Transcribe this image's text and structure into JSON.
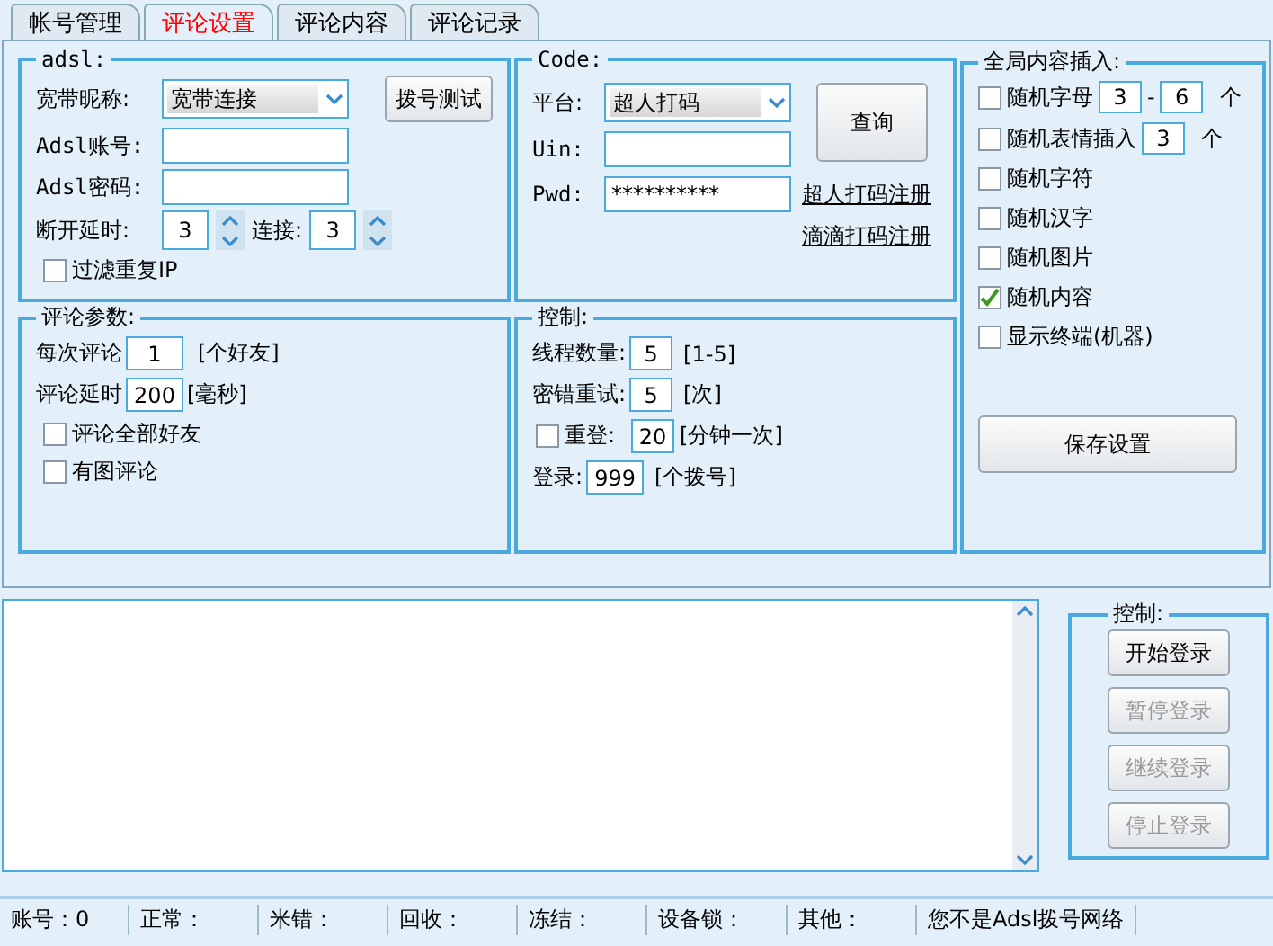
{
  "tabs": [
    {
      "label": "帐号管理",
      "selected": false
    },
    {
      "label": "评论设置",
      "selected": true
    },
    {
      "label": "评论内容",
      "selected": false
    },
    {
      "label": "评论记录",
      "selected": false
    }
  ],
  "adsl": {
    "legend": "adsl:",
    "nickname": {
      "label": "宽带昵称:",
      "value": "宽带连接"
    },
    "account": {
      "label": "Adsl账号:"
    },
    "password": {
      "label": "Adsl密码:"
    },
    "dial_test_button": "拨号测试",
    "delay": {
      "label": "断开延时:",
      "value": "3"
    },
    "connect": {
      "label": "连接:",
      "value": "3"
    },
    "filter_ip": {
      "label": "过滤重复IP",
      "checked": false
    }
  },
  "comment_params": {
    "legend": "评论参数:",
    "rows": [
      {
        "label": "每次评论",
        "value": "1",
        "unit": "[个好友]"
      },
      {
        "label": "评论延时",
        "value": "200",
        "unit": "[毫秒]"
      }
    ],
    "checkboxes": [
      {
        "label": "评论全部好友",
        "checked": false
      },
      {
        "label": "有图评论",
        "checked": false
      }
    ]
  },
  "code": {
    "legend": "Code:",
    "platform": {
      "label": "平台:",
      "value": "超人打码"
    },
    "uin": {
      "label": "Uin:"
    },
    "pwd": {
      "label": "Pwd:",
      "value": "**********"
    },
    "query_button": "查询",
    "links": [
      "超人打码注册",
      "滴滴打码注册"
    ]
  },
  "control": {
    "legend": "控制:",
    "rows": [
      {
        "kind": "field",
        "label": "线程数量:",
        "value": "5",
        "unit": "[1-5]"
      },
      {
        "kind": "field",
        "label": "密错重试:",
        "value": "5",
        "unit": "[次]"
      },
      {
        "kind": "checkbox",
        "label": "重登:",
        "checked": false,
        "value": "20",
        "unit": "[分钟一次]"
      },
      {
        "kind": "field",
        "label": "登录:",
        "value": "999",
        "unit": "[个拨号]"
      }
    ]
  },
  "global_insert": {
    "legend": "全局内容插入:",
    "options": [
      {
        "label": "随机字母",
        "checked": false,
        "values": [
          "3",
          "6"
        ],
        "separator": "-",
        "unit": "个"
      },
      {
        "label": "随机表情插入",
        "checked": false,
        "values": [
          "3"
        ],
        "unit": "个"
      },
      {
        "label": "随机字符",
        "checked": false
      },
      {
        "label": "随机汉字",
        "checked": false
      },
      {
        "label": "随机图片",
        "checked": false
      },
      {
        "label": "随机内容",
        "checked": true
      },
      {
        "label": "显示终端(机器)",
        "checked": false
      }
    ],
    "save_button": "保存设置"
  },
  "control_panel": {
    "legend": "控制:",
    "buttons": [
      {
        "label": "开始登录",
        "disabled": false
      },
      {
        "label": "暂停登录",
        "disabled": true
      },
      {
        "label": "继续登录",
        "disabled": true
      },
      {
        "label": "停止登录",
        "disabled": true
      }
    ]
  },
  "status_bar": [
    "账号：0",
    "正常：",
    "米错：",
    "回收：",
    "冻结：",
    "设备锁：",
    "其他：",
    "您不是Adsl拨号网络"
  ]
}
